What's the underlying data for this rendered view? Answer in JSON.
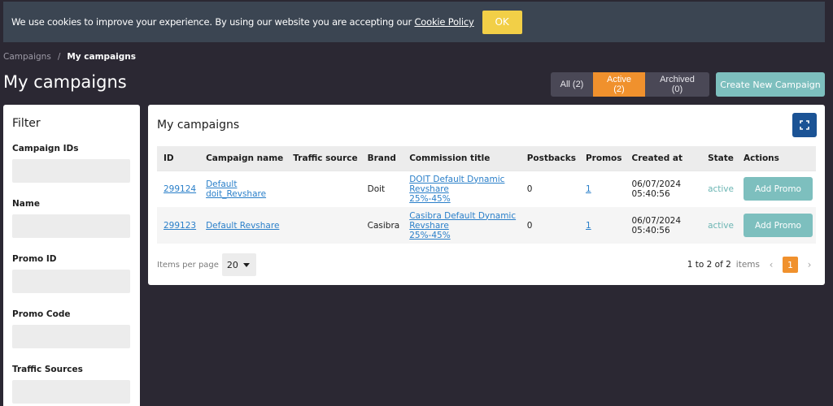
{
  "cookie": {
    "text": "We use cookies to improve your experience. By using our website you are accepting our ",
    "link": "Cookie Policy",
    "ok_label": "OK"
  },
  "breadcrumb": {
    "parent": "Campaigns",
    "separator": "/",
    "current": "My campaigns"
  },
  "page_title": "My campaigns",
  "state_tabs": [
    {
      "label": "All (2)"
    },
    {
      "label": "Active (2)",
      "active": true
    },
    {
      "label": "Archived (0)"
    }
  ],
  "create_button": "Create New Campaign",
  "filter": {
    "title": "Filter",
    "fields": [
      {
        "label": "Campaign IDs",
        "value": ""
      },
      {
        "label": "Name",
        "value": ""
      },
      {
        "label": "Promo ID",
        "value": ""
      },
      {
        "label": "Promo Code",
        "value": ""
      },
      {
        "label": "Traffic Sources",
        "value": ""
      }
    ]
  },
  "campaigns": {
    "title": "My campaigns",
    "expand_icon": "expand-icon",
    "columns": [
      "ID",
      "Campaign name",
      "Traffic source",
      "Brand",
      "Commission title",
      "Postbacks",
      "Promos",
      "Created at",
      "State",
      "Actions"
    ],
    "rows": [
      {
        "id": "299124",
        "name_line1": "Default",
        "name_line2": "doit_Revshare",
        "traffic_source": "",
        "brand": "Doit",
        "commission_line1": "DOIT Default Dynamic Revshare",
        "commission_line2": "25%-45%",
        "postbacks": "0",
        "promos": "1",
        "created_at": "06/07/2024 05:40:56",
        "state": "active",
        "action": "Add Promo"
      },
      {
        "id": "299123",
        "name_line1": "Default Revshare",
        "name_line2": "",
        "traffic_source": "",
        "brand": "Casibra",
        "commission_line1": "Casibra Default Dynamic Revshare",
        "commission_line2": "25%-45%",
        "postbacks": "0",
        "promos": "1",
        "created_at": "06/07/2024 05:40:56",
        "state": "active",
        "action": "Add Promo"
      }
    ],
    "footer": {
      "items_per_page_label": "Items per page",
      "items_per_page_value": "20",
      "range": "1 to 2 of 2",
      "items_word": "items",
      "current_page": "1"
    }
  },
  "colors": {
    "background": "#2b2833",
    "banner": "#3b4552",
    "accent_orange": "#f0912d",
    "accent_teal": "#7dbfbe",
    "cookie_ok": "#f2cf47",
    "expand_button": "#1b5395",
    "link": "#2a7fc9"
  }
}
